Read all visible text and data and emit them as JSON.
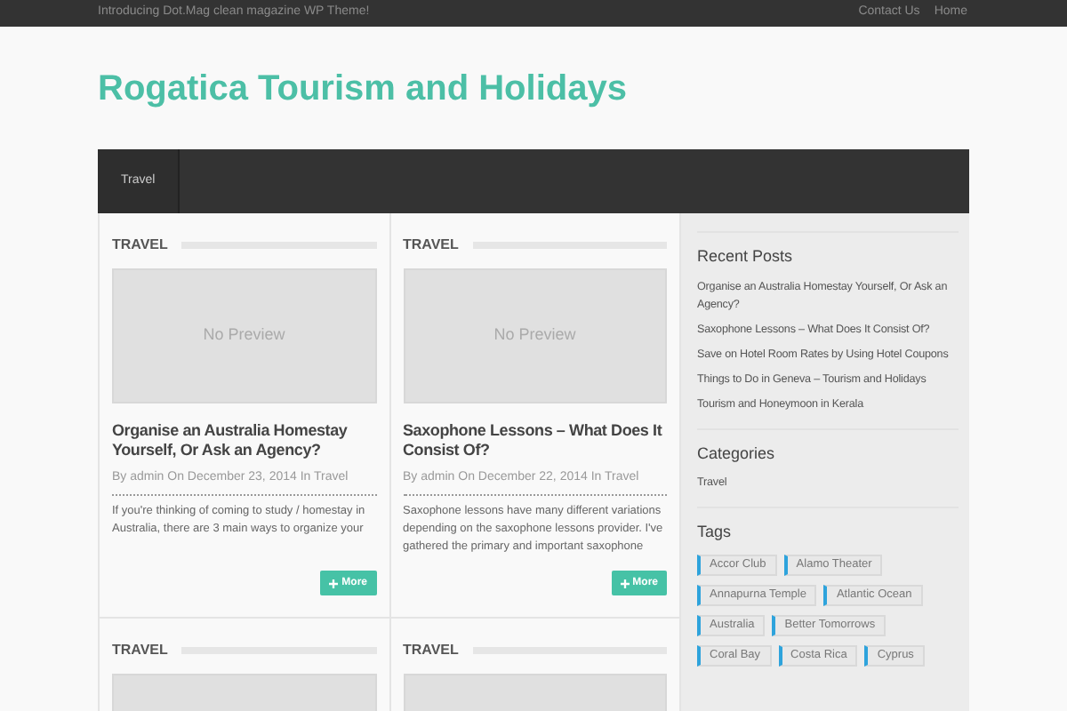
{
  "top_bar": {
    "tagline": "Introducing Dot.Mag clean magazine WP Theme!",
    "links": [
      "Contact Us",
      "Home"
    ]
  },
  "site_title": "Rogatica Tourism and Holidays",
  "nav": [
    {
      "label": "Travel",
      "selected": true
    }
  ],
  "posts": [
    {
      "category": "TRAVEL",
      "preview": "No Preview",
      "title": "Organise an Australia Homestay Yourself, Or Ask an Agency?",
      "meta": "By admin On December 23, 2014 In Travel",
      "excerpt": "If you're thinking of coming to study / homestay in Australia, there are 3 main ways to organize your",
      "more": "More"
    },
    {
      "category": "TRAVEL",
      "preview": "No Preview",
      "title": "Saxophone Lessons – What Does It Consist Of?",
      "meta": "By admin On December 22, 2014 In Travel",
      "excerpt": "Saxophone lessons have many different variations depending on the saxophone lessons provider. I've gathered the primary and important saxophone",
      "more": "More"
    },
    {
      "category": "TRAVEL"
    },
    {
      "category": "TRAVEL"
    }
  ],
  "sidebar": {
    "recent_posts": {
      "title": "Recent Posts",
      "items": [
        "Organise an Australia Homestay Yourself, Or Ask an Agency?",
        "Saxophone Lessons – What Does It Consist Of?",
        "Save on Hotel Room Rates by Using Hotel Coupons",
        "Things to Do in Geneva – Tourism and Holidays",
        "Tourism and Honeymoon in Kerala"
      ]
    },
    "categories": {
      "title": "Categories",
      "items": [
        "Travel"
      ]
    },
    "tags": {
      "title": "Tags",
      "items": [
        "Accor Club",
        "Alamo Theater",
        "Annapurna Temple",
        "Atlantic Ocean",
        "Australia",
        "Better Tomorrows",
        "Coral Bay",
        "Costa Rica",
        "Cyprus"
      ]
    }
  }
}
